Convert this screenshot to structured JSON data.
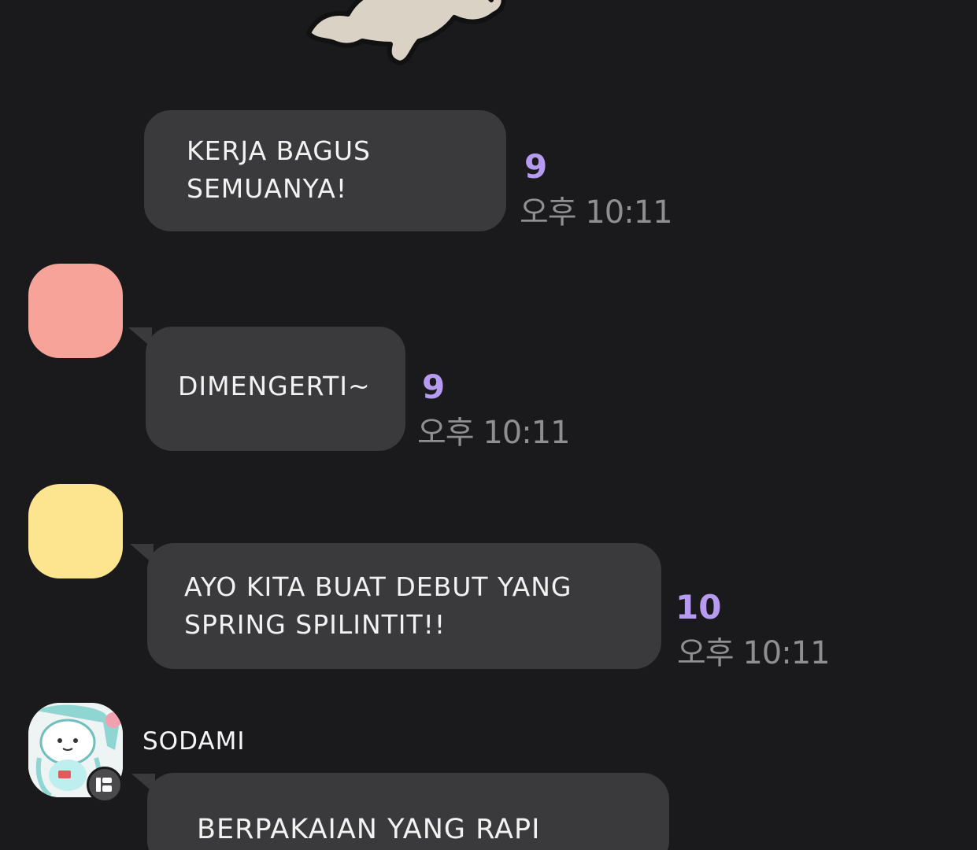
{
  "chat": {
    "messages": [
      {
        "text": [
          "KERJA BAGUS",
          "SEMUANYA!"
        ],
        "count": "9",
        "time": "오후 10:11"
      },
      {
        "text": [
          "DIMENGERTI~"
        ],
        "count": "9",
        "time": "오후 10:11"
      },
      {
        "text": [
          "AYO KITA BUAT DEBUT YANG",
          "SPRING SPILINTIT!!"
        ],
        "count": "10",
        "time": "오후 10:11"
      },
      {
        "sender": "SODAMI",
        "text": [
          "BERPAKAIAN YANG RAPI"
        ]
      }
    ]
  },
  "colors": {
    "background": "#1a1a1c",
    "bubble": "#3a3a3c",
    "read_count": "#b79bf0",
    "timestamp": "#8f8f93",
    "avatar_pink": "#f8a39a",
    "avatar_yellow": "#fde58f"
  },
  "icons": [
    "dog-sticker",
    "profile-avatar",
    "avatar-badge-icon"
  ]
}
